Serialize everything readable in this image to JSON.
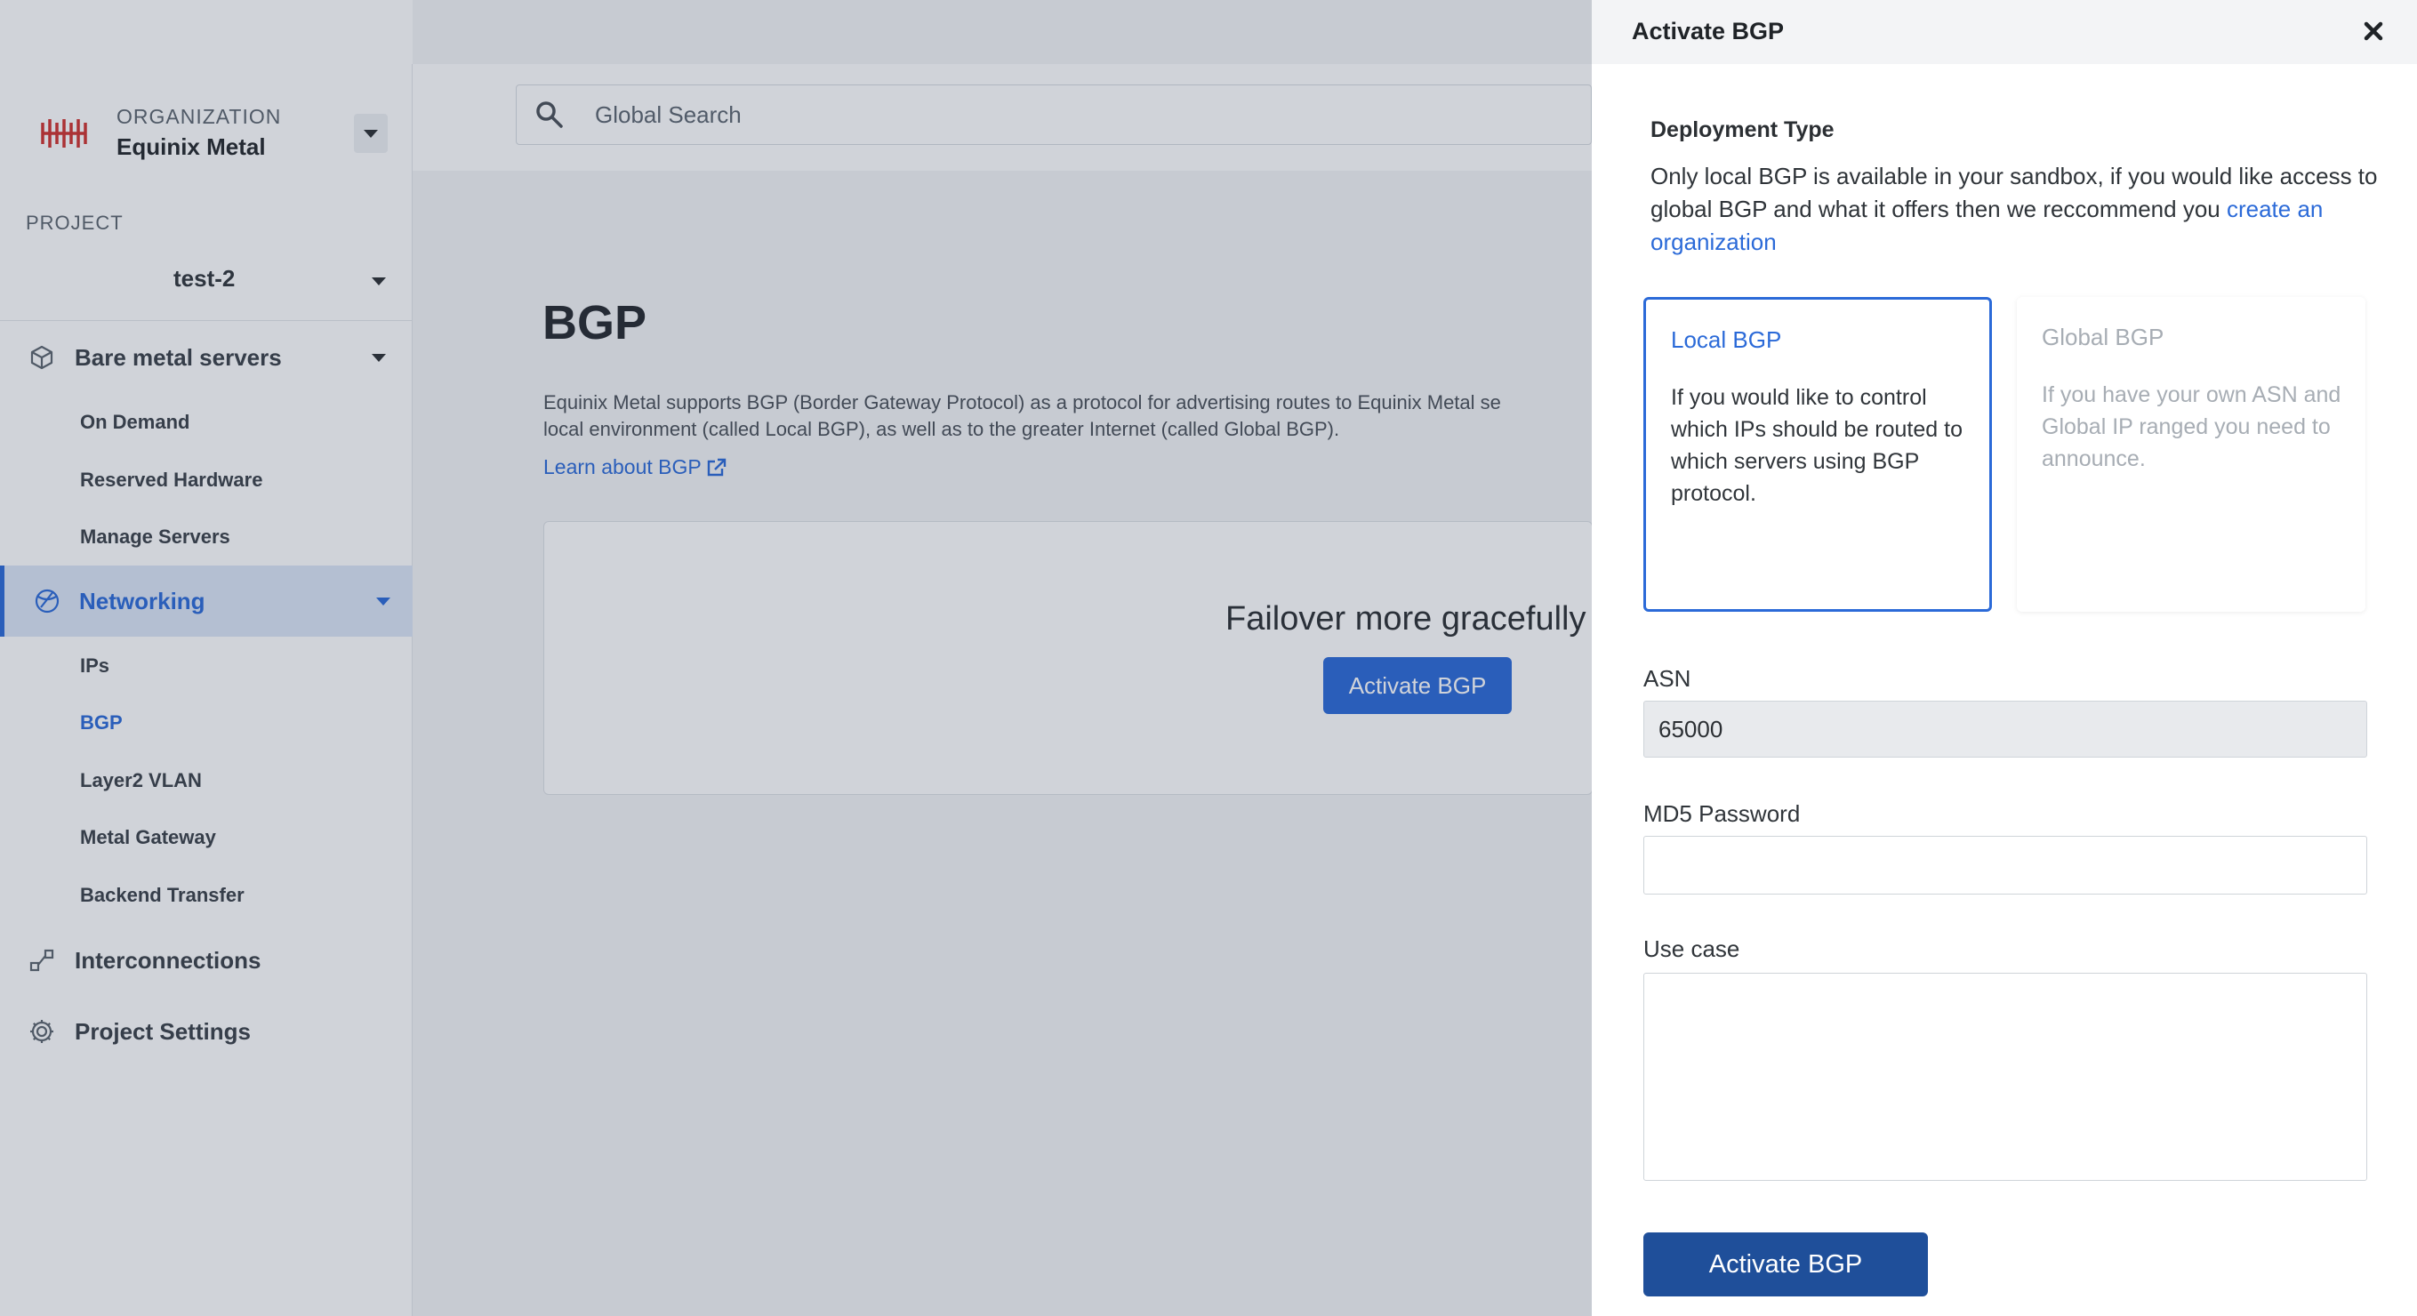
{
  "sidebar": {
    "organization_label": "ORGANIZATION",
    "organization_name": "Equinix Metal",
    "project_label": "PROJECT",
    "project_name": "test-2",
    "sections": {
      "bare_metal": {
        "label": "Bare metal servers",
        "icon": "cube-icon"
      },
      "networking": {
        "label": "Networking",
        "icon": "globe-icon"
      },
      "interconnections": {
        "label": "Interconnections",
        "icon": "link-icon"
      },
      "project_settings": {
        "label": "Project Settings",
        "icon": "gear-icon"
      }
    },
    "bare_metal_items": [
      "On Demand",
      "Reserved Hardware",
      "Manage Servers"
    ],
    "networking_items": [
      "IPs",
      "BGP",
      "Layer2 VLAN",
      "Metal Gateway",
      "Backend Transfer"
    ],
    "active_item": "BGP"
  },
  "search": {
    "placeholder": "Global Search"
  },
  "main": {
    "title": "BGP",
    "description": "Equinix Metal supports BGP (Border Gateway Protocol) as a protocol for advertising routes to Equinix Metal se\nlocal environment (called Local BGP), as well as to the greater Internet (called Global BGP).",
    "learn_link": "Learn about BGP",
    "promo_heading": "Failover more gracefully",
    "promo_button": "Activate BGP"
  },
  "drawer": {
    "title": "Activate BGP",
    "deployment_type_title": "Deployment Type",
    "deployment_desc": "Only local BGP is available in your sandbox, if you would like access to global BGP and what it offers then we reccommend you",
    "deployment_link": "create an organization",
    "options": {
      "local": {
        "title": "Local BGP",
        "desc": "If you would like to control which IPs should be routed to which servers using BGP protocol."
      },
      "global": {
        "title": "Global BGP",
        "desc": "If you have your own ASN and Global IP ranged you need to announce."
      }
    },
    "asn_label": "ASN",
    "asn_value": "65000",
    "md5_label": "MD5 Password",
    "md5_value": "",
    "use_case_label": "Use case",
    "use_case_value": "",
    "submit_label": "Activate BGP"
  },
  "colors": {
    "accent": "#2b6ad8",
    "submit": "#1f4f9a",
    "logo": "#d0312d"
  }
}
